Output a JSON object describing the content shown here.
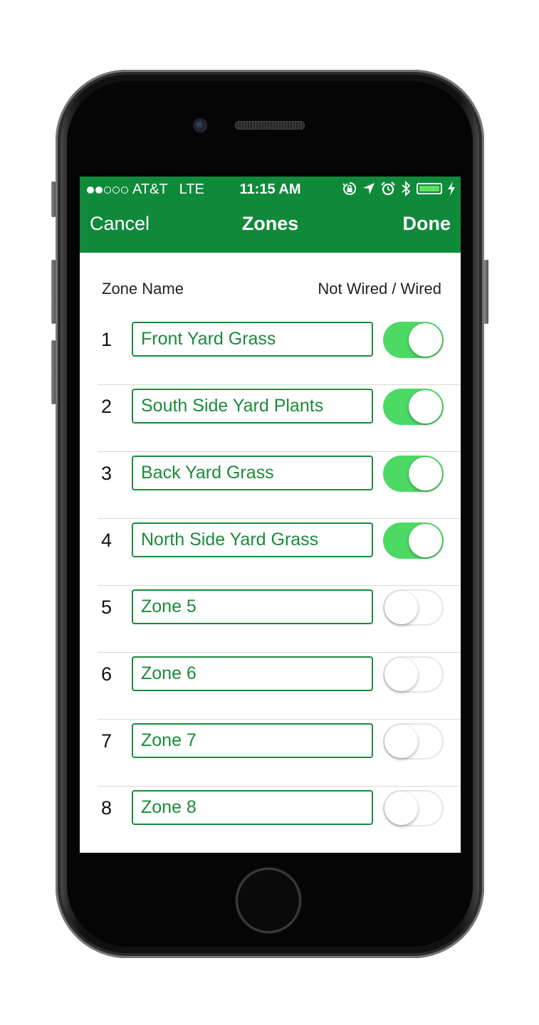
{
  "status_bar": {
    "signal_dots_filled": 2,
    "signal_dots_total": 5,
    "carrier": "AT&T",
    "network": "LTE",
    "time": "11:15 AM",
    "icons": [
      "rotation-lock-icon",
      "location-arrow-icon",
      "alarm-icon",
      "bluetooth-icon",
      "battery-icon",
      "charging-bolt-icon"
    ],
    "battery_level": 1.0
  },
  "nav": {
    "cancel_label": "Cancel",
    "title": "Zones",
    "done_label": "Done"
  },
  "columns": {
    "left": "Zone Name",
    "right": "Not Wired / Wired"
  },
  "zones": [
    {
      "number": "1",
      "name": "Front Yard Grass",
      "wired": true
    },
    {
      "number": "2",
      "name": "South Side Yard Plants",
      "wired": true
    },
    {
      "number": "3",
      "name": "Back Yard Grass",
      "wired": true
    },
    {
      "number": "4",
      "name": "North Side Yard Grass",
      "wired": true
    },
    {
      "number": "5",
      "name": "Zone 5",
      "wired": false
    },
    {
      "number": "6",
      "name": "Zone 6",
      "wired": false
    },
    {
      "number": "7",
      "name": "Zone 7",
      "wired": false
    },
    {
      "number": "8",
      "name": "Zone 8",
      "wired": false
    }
  ],
  "colors": {
    "header_green": "#0f8a3a",
    "field_green": "#1a8b3a",
    "toggle_on": "#4cd964"
  }
}
